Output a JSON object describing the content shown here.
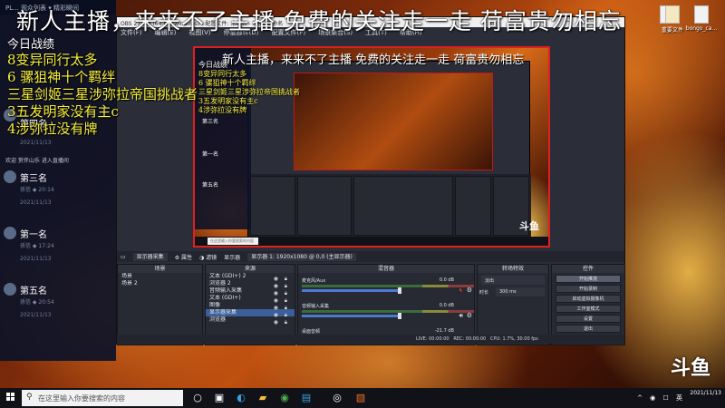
{
  "overlay": {
    "headline": "新人主播，来来不了主播 免费的关注走一走 荷富贵勿相忘",
    "stats_title": "今日战绩",
    "stats": [
      "8变异同行太多",
      "6 骡狙神十个羁绊",
      "三星剑姬三星涉弥拉帝国挑战者",
      "3五发明家没有主c",
      "4涉弥拉没有牌"
    ]
  },
  "chat": {
    "header": "PL... 观众列表  ▾ 精彩瞬间",
    "entries": [
      {
        "name": "第三名",
        "sub": "孫信 ◆  20:14",
        "date": "2021/11/13"
      },
      {
        "name": "第一名",
        "sub": "孫信 ◆  17:24",
        "date": "2021/11/13"
      },
      {
        "name": "第五名",
        "sub": "孫信 ◆  20:54",
        "date": "2021/11/13"
      }
    ],
    "join_text": "欢迎 赏伴山乐 进入直播间",
    "top_entry": {
      "name": "第四名",
      "date": "2021/11/13"
    }
  },
  "desktop_icons": [
    {
      "label": ""
    },
    {
      "label": "重要文件"
    },
    {
      "label": "bongo_ca..."
    }
  ],
  "obs": {
    "title": "OBS 27.1.3 (64-bit, windows) - 配置文件: 未命名 - 场景: 未命名",
    "menu": [
      "文件(F)",
      "编辑(E)",
      "视图(V)",
      "停靠部件(D)",
      "配置文件(P)",
      "场景集合(S)",
      "工具(T)",
      "帮助(H)"
    ],
    "source_bar": {
      "selected": "显示器采集",
      "properties": "属性",
      "filters": "滤镜",
      "display_label": "显示器",
      "display_value": "显示器 1: 1920x1080 @ 0,0 (主显示器)"
    },
    "docks": {
      "scenes": {
        "title": "场景",
        "items": [
          "场景",
          "场景 2"
        ]
      },
      "sources": {
        "title": "来源",
        "items": [
          "文本 (GDI+) 2",
          "浏览器 2",
          "音频输入采集",
          "文本 (GDI+)",
          "图像",
          "显示器采集",
          "浏览器"
        ]
      },
      "mixer": {
        "title": "混音器",
        "channels": [
          {
            "name": "麦克风/Aux",
            "db": "0.0 dB",
            "muted": true
          },
          {
            "name": "音频输入采集",
            "db": "0.0 dB",
            "muted": false
          },
          {
            "name": "桌面音频",
            "db": "-21.7 dB",
            "muted": false
          }
        ]
      },
      "transitions": {
        "title": "转场特效",
        "type": "淡出",
        "duration_label": "时长",
        "duration_value": "300 ms"
      },
      "controls": {
        "title": "控件",
        "buttons": [
          "开始推流",
          "开始录制",
          "启动虚拟摄像机",
          "工作室模式",
          "设置",
          "退出"
        ]
      }
    },
    "status": {
      "live": "LIVE: 00:00:00",
      "rec": "REC: 00:00:00",
      "cpu": "CPU: 1.7%, 30.00 fps"
    }
  },
  "preview_logo": "斗鱼",
  "brand_logo": "斗鱼",
  "taskbar": {
    "search_placeholder": "在这里输入你要搜索的内容",
    "icons": [
      "task-view",
      "edge",
      "explorer",
      "chrome",
      "obs",
      "app"
    ],
    "tray_icons": "^ ◉ ☐ 英",
    "date": "2021/11/13",
    "time": ""
  }
}
